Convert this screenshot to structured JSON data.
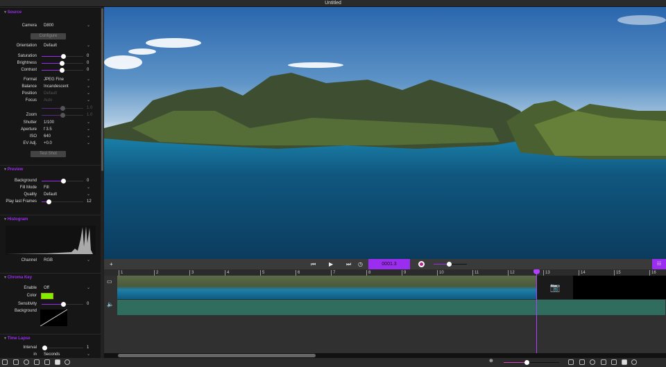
{
  "window": {
    "title": "Untitled"
  },
  "source": {
    "title": "Source",
    "camera": {
      "label": "Camera",
      "value": "D800"
    },
    "configure": "Configure",
    "orientation": {
      "label": "Orientation",
      "value": "Default"
    },
    "saturation": {
      "label": "Saturation",
      "value": "0",
      "level": 0.5
    },
    "brightness": {
      "label": "Brightness",
      "value": "0",
      "level": 0.48
    },
    "contrast": {
      "label": "Contrast",
      "value": "0",
      "level": 0.48
    },
    "format": {
      "label": "Format",
      "value": "JPEG Fine"
    },
    "balance": {
      "label": "Balance",
      "value": "Incandescent"
    },
    "position": {
      "label": "Position",
      "value": "Default"
    },
    "focus": {
      "label": "Focus",
      "value": "Auto"
    },
    "focus_slider": {
      "value": "1.0",
      "level": 0.5
    },
    "zoom": {
      "label": "Zoom",
      "value": "1.0",
      "level": 0.5
    },
    "shutter": {
      "label": "Shutter",
      "value": "1/100"
    },
    "aperture": {
      "label": "Aperture",
      "value": "f 3.5"
    },
    "iso": {
      "label": "ISO",
      "value": "640"
    },
    "ev": {
      "label": "EV Adj.",
      "value": "+0.0"
    },
    "test_shot": "Test Shot"
  },
  "preview": {
    "title": "Preview",
    "background": {
      "label": "Background",
      "value": "0",
      "level": 0.5
    },
    "fill_mode": {
      "label": "Fill Mode",
      "value": "Fill"
    },
    "quality": {
      "label": "Quality",
      "value": "Default"
    },
    "play_last": {
      "label": "Play last Frames",
      "value": "12",
      "level": 0.16
    }
  },
  "histogram": {
    "title": "Histogram",
    "channel": {
      "label": "Channel",
      "value": "RGB"
    }
  },
  "chroma": {
    "title": "Chroma Key",
    "enable": {
      "label": "Enable",
      "value": "Off"
    },
    "color": {
      "label": "Color",
      "hex": "#7df000"
    },
    "sensitivity": {
      "label": "Sensitivity",
      "value": "0",
      "level": 0.5
    },
    "background": {
      "label": "Background"
    }
  },
  "timelapse": {
    "title": "Time Lapse",
    "interval": {
      "label": "Interval",
      "value": "1",
      "level": 0.05
    },
    "in": {
      "label": "in",
      "value": "Seconds"
    }
  },
  "transport": {
    "frame": "0001.3",
    "add": "+"
  },
  "ruler": [
    "1",
    "2",
    "3",
    "4",
    "5",
    "6",
    "7",
    "8",
    "9",
    "10",
    "11",
    "12",
    "13",
    "14",
    "15",
    "16"
  ],
  "colors": {
    "accent": "#9b2df0"
  }
}
